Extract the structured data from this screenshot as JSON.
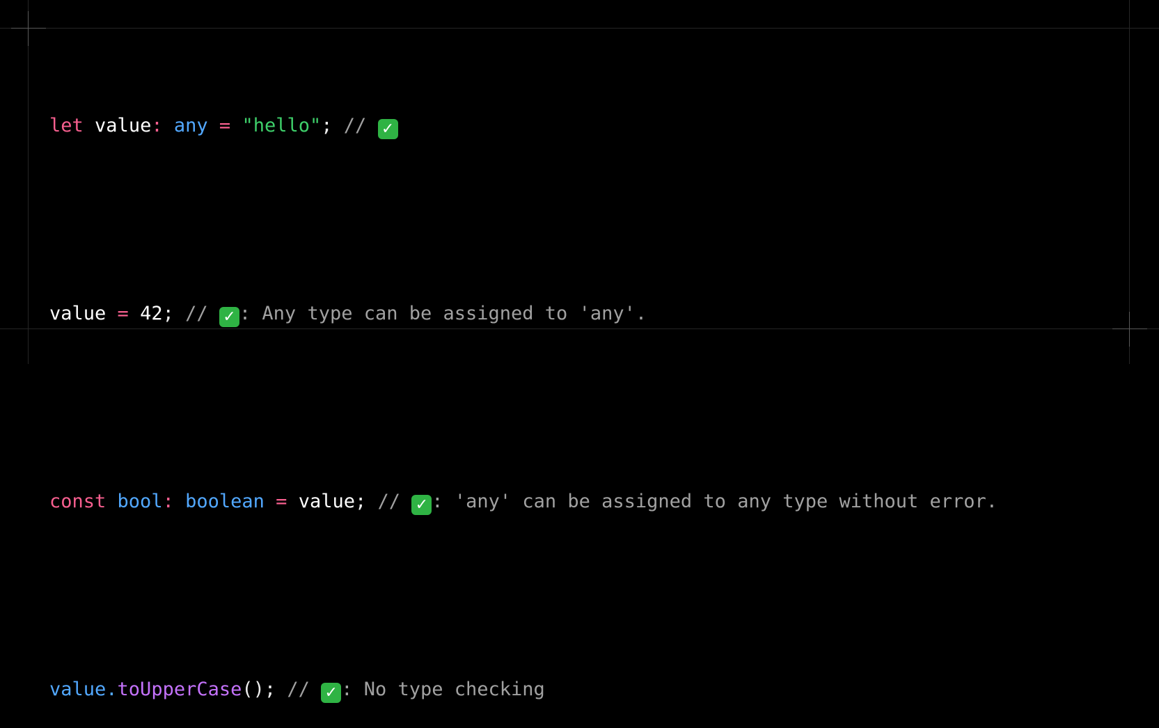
{
  "icons": {
    "check": "check-mark-icon",
    "check_glyph": "✓",
    "check_color": "#2fb344"
  },
  "colors": {
    "background": "#000000",
    "keyword": "#f75f8f",
    "type": "#52a8ff",
    "string": "#3ecf6a",
    "method": "#c472fb",
    "comment": "#a1a1a1",
    "text": "#ededed"
  },
  "code": {
    "line1": {
      "kw": "let",
      "name": "value",
      "colon": ":",
      "type": "any",
      "eq": "=",
      "str": "\"hello\"",
      "semi": ";",
      "comment": "//"
    },
    "line2": {
      "name": "value",
      "eq": "=",
      "num": "42",
      "semi": ";",
      "comment_start": "//",
      "comment_text": ": Any type can be assigned to 'any'."
    },
    "line3": {
      "kw": "const",
      "name": "bool",
      "colon": ":",
      "type": "boolean",
      "eq": "=",
      "value": "value",
      "semi": ";",
      "comment_start": "//",
      "comment_text": ": 'any' can be assigned to any type without error."
    },
    "line4": {
      "obj": "value",
      "dot": ".",
      "method": "toUpperCase",
      "call": "()",
      "semi": ";",
      "comment_start": "//",
      "comment_text": ": No type checking"
    }
  }
}
